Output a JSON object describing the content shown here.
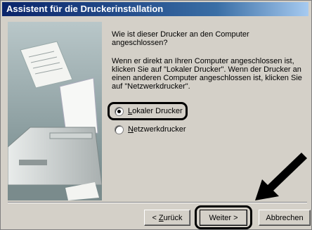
{
  "window": {
    "title": "Assistent für die Druckerinstallation"
  },
  "content": {
    "question": "Wie ist dieser Drucker an den Computer angeschlossen?",
    "info": "Wenn er direkt an Ihren Computer angeschlossen ist, klicken Sie auf \"Lokaler Drucker\". Wenn der Drucker an einen anderen Computer angeschlossen ist, klicken Sie auf \"Netzwerkdrucker\".",
    "options": [
      {
        "label_access": "L",
        "label_rest": "okaler Drucker",
        "selected": true
      },
      {
        "label_access": "N",
        "label_rest": "etzwerkdrucker",
        "selected": false
      }
    ]
  },
  "buttons": {
    "back": {
      "prefix": "< ",
      "access": "Z",
      "rest": "urück"
    },
    "next": "Weiter >",
    "cancel": "Abbrechen"
  },
  "colors": {
    "title_start": "#0a246a",
    "title_end": "#a6caf0",
    "dialog_bg": "#d4d0c8"
  },
  "icons": [
    "printer-illustration",
    "pointer-arrow"
  ]
}
